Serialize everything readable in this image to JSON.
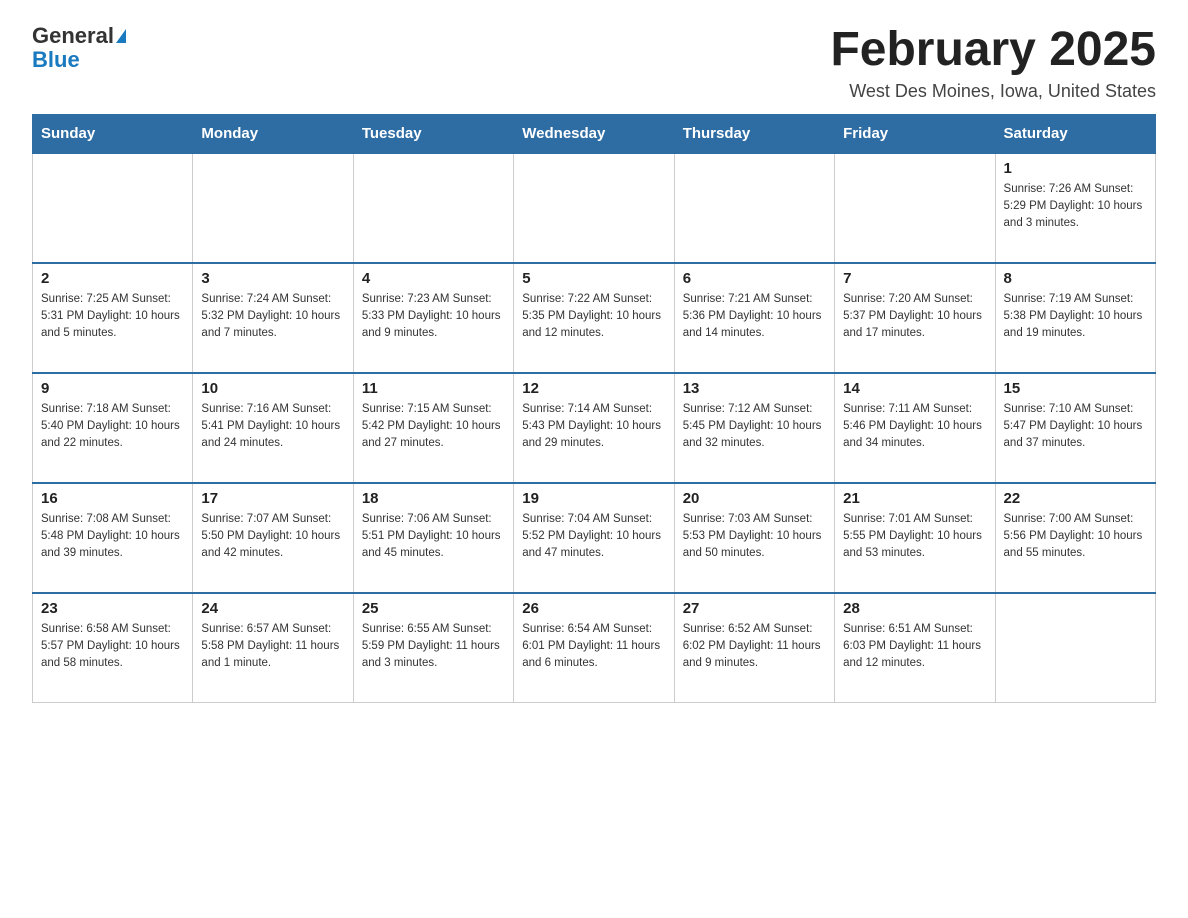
{
  "header": {
    "logo_general": "General",
    "logo_blue": "Blue",
    "month_title": "February 2025",
    "location": "West Des Moines, Iowa, United States"
  },
  "days_of_week": [
    "Sunday",
    "Monday",
    "Tuesday",
    "Wednesday",
    "Thursday",
    "Friday",
    "Saturday"
  ],
  "weeks": [
    [
      {
        "day": "",
        "info": ""
      },
      {
        "day": "",
        "info": ""
      },
      {
        "day": "",
        "info": ""
      },
      {
        "day": "",
        "info": ""
      },
      {
        "day": "",
        "info": ""
      },
      {
        "day": "",
        "info": ""
      },
      {
        "day": "1",
        "info": "Sunrise: 7:26 AM\nSunset: 5:29 PM\nDaylight: 10 hours and 3 minutes."
      }
    ],
    [
      {
        "day": "2",
        "info": "Sunrise: 7:25 AM\nSunset: 5:31 PM\nDaylight: 10 hours and 5 minutes."
      },
      {
        "day": "3",
        "info": "Sunrise: 7:24 AM\nSunset: 5:32 PM\nDaylight: 10 hours and 7 minutes."
      },
      {
        "day": "4",
        "info": "Sunrise: 7:23 AM\nSunset: 5:33 PM\nDaylight: 10 hours and 9 minutes."
      },
      {
        "day": "5",
        "info": "Sunrise: 7:22 AM\nSunset: 5:35 PM\nDaylight: 10 hours and 12 minutes."
      },
      {
        "day": "6",
        "info": "Sunrise: 7:21 AM\nSunset: 5:36 PM\nDaylight: 10 hours and 14 minutes."
      },
      {
        "day": "7",
        "info": "Sunrise: 7:20 AM\nSunset: 5:37 PM\nDaylight: 10 hours and 17 minutes."
      },
      {
        "day": "8",
        "info": "Sunrise: 7:19 AM\nSunset: 5:38 PM\nDaylight: 10 hours and 19 minutes."
      }
    ],
    [
      {
        "day": "9",
        "info": "Sunrise: 7:18 AM\nSunset: 5:40 PM\nDaylight: 10 hours and 22 minutes."
      },
      {
        "day": "10",
        "info": "Sunrise: 7:16 AM\nSunset: 5:41 PM\nDaylight: 10 hours and 24 minutes."
      },
      {
        "day": "11",
        "info": "Sunrise: 7:15 AM\nSunset: 5:42 PM\nDaylight: 10 hours and 27 minutes."
      },
      {
        "day": "12",
        "info": "Sunrise: 7:14 AM\nSunset: 5:43 PM\nDaylight: 10 hours and 29 minutes."
      },
      {
        "day": "13",
        "info": "Sunrise: 7:12 AM\nSunset: 5:45 PM\nDaylight: 10 hours and 32 minutes."
      },
      {
        "day": "14",
        "info": "Sunrise: 7:11 AM\nSunset: 5:46 PM\nDaylight: 10 hours and 34 minutes."
      },
      {
        "day": "15",
        "info": "Sunrise: 7:10 AM\nSunset: 5:47 PM\nDaylight: 10 hours and 37 minutes."
      }
    ],
    [
      {
        "day": "16",
        "info": "Sunrise: 7:08 AM\nSunset: 5:48 PM\nDaylight: 10 hours and 39 minutes."
      },
      {
        "day": "17",
        "info": "Sunrise: 7:07 AM\nSunset: 5:50 PM\nDaylight: 10 hours and 42 minutes."
      },
      {
        "day": "18",
        "info": "Sunrise: 7:06 AM\nSunset: 5:51 PM\nDaylight: 10 hours and 45 minutes."
      },
      {
        "day": "19",
        "info": "Sunrise: 7:04 AM\nSunset: 5:52 PM\nDaylight: 10 hours and 47 minutes."
      },
      {
        "day": "20",
        "info": "Sunrise: 7:03 AM\nSunset: 5:53 PM\nDaylight: 10 hours and 50 minutes."
      },
      {
        "day": "21",
        "info": "Sunrise: 7:01 AM\nSunset: 5:55 PM\nDaylight: 10 hours and 53 minutes."
      },
      {
        "day": "22",
        "info": "Sunrise: 7:00 AM\nSunset: 5:56 PM\nDaylight: 10 hours and 55 minutes."
      }
    ],
    [
      {
        "day": "23",
        "info": "Sunrise: 6:58 AM\nSunset: 5:57 PM\nDaylight: 10 hours and 58 minutes."
      },
      {
        "day": "24",
        "info": "Sunrise: 6:57 AM\nSunset: 5:58 PM\nDaylight: 11 hours and 1 minute."
      },
      {
        "day": "25",
        "info": "Sunrise: 6:55 AM\nSunset: 5:59 PM\nDaylight: 11 hours and 3 minutes."
      },
      {
        "day": "26",
        "info": "Sunrise: 6:54 AM\nSunset: 6:01 PM\nDaylight: 11 hours and 6 minutes."
      },
      {
        "day": "27",
        "info": "Sunrise: 6:52 AM\nSunset: 6:02 PM\nDaylight: 11 hours and 9 minutes."
      },
      {
        "day": "28",
        "info": "Sunrise: 6:51 AM\nSunset: 6:03 PM\nDaylight: 11 hours and 12 minutes."
      },
      {
        "day": "",
        "info": ""
      }
    ]
  ]
}
